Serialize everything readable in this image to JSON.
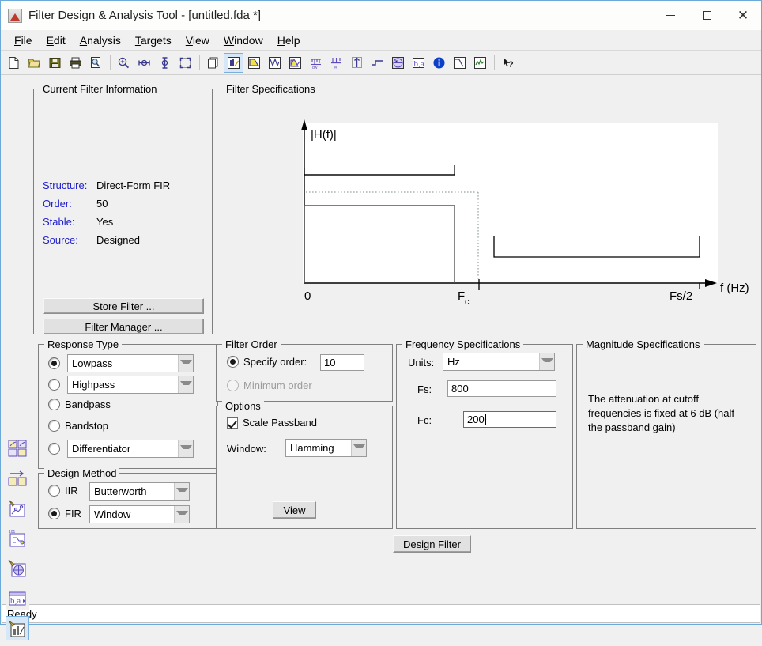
{
  "window": {
    "title": "Filter Design & Analysis Tool -  [untitled.fda *]",
    "app_icon": "matlab-fdatool-icon",
    "controls": {
      "minimize": "minimize-icon",
      "maximize": "maximize-icon",
      "close": "close-icon"
    }
  },
  "menubar": [
    {
      "label": "File",
      "mnemonic": "F"
    },
    {
      "label": "Edit",
      "mnemonic": "E"
    },
    {
      "label": "Analysis",
      "mnemonic": "A"
    },
    {
      "label": "Targets",
      "mnemonic": "T"
    },
    {
      "label": "View",
      "mnemonic": "V"
    },
    {
      "label": "Window",
      "mnemonic": "W"
    },
    {
      "label": "Help",
      "mnemonic": "H"
    }
  ],
  "toolbar": [
    {
      "name": "new-filter-icon",
      "tip": "New"
    },
    {
      "name": "open-icon",
      "tip": "Open"
    },
    {
      "name": "save-icon",
      "tip": "Save"
    },
    {
      "name": "print-icon",
      "tip": "Print"
    },
    {
      "name": "print-preview-icon",
      "tip": "Print Preview"
    },
    {
      "name": "zoom-in-icon",
      "tip": "Zoom In"
    },
    {
      "name": "zoom-x-icon",
      "tip": "Zoom X"
    },
    {
      "name": "zoom-y-icon",
      "tip": "Zoom Y"
    },
    {
      "name": "full-view-icon",
      "tip": "Full View"
    },
    {
      "name": "new-window-icon",
      "tip": "Print to Figure"
    },
    {
      "name": "filter-specifications-icon",
      "tip": "Filter Specifications",
      "active": true
    },
    {
      "name": "magnitude-response-icon",
      "tip": "Magnitude Response"
    },
    {
      "name": "phase-response-icon",
      "tip": "Phase Response"
    },
    {
      "name": "magnitude-and-phase-icon",
      "tip": "Magnitude and Phase Response"
    },
    {
      "name": "group-delay-icon",
      "tip": "Group Delay Response"
    },
    {
      "name": "phase-delay-icon",
      "tip": "Phase Delay"
    },
    {
      "name": "impulse-response-icon",
      "tip": "Impulse Response"
    },
    {
      "name": "step-response-icon",
      "tip": "Step Response"
    },
    {
      "name": "pole-zero-plot-icon",
      "tip": "Pole/Zero Plot"
    },
    {
      "name": "filter-coefficients-icon",
      "tip": "Filter Coefficients"
    },
    {
      "name": "filter-information-icon",
      "tip": "Filter Information"
    },
    {
      "name": "magnitude-specifications-icon",
      "tip": "Magnitude Specifications"
    },
    {
      "name": "round-off-noise-icon",
      "tip": "Round-off Noise Power Spectrum"
    },
    {
      "name": "help-pointer-icon",
      "tip": "Context Help"
    }
  ],
  "side_toolbar": [
    {
      "name": "design-filter-sidebar-icon",
      "tip": "Design Filter"
    },
    {
      "name": "import-filter-icon",
      "tip": "Import Filter"
    },
    {
      "name": "pole-zero-editor-icon",
      "tip": "Pole/Zero Editor"
    },
    {
      "name": "set-quantization-parameters-icon",
      "tip": "Set Quantization Parameters"
    },
    {
      "name": "transform-filter-icon",
      "tip": "Transform Filter"
    },
    {
      "name": "realize-model-icon",
      "tip": "Realize Model"
    },
    {
      "name": "design-multirate-filter-icon",
      "tip": "Design Multirate Filter",
      "active": true
    }
  ],
  "current_filter_information": {
    "legend": "Current Filter Information",
    "rows": [
      {
        "label": "Structure:",
        "value": "Direct-Form FIR"
      },
      {
        "label": "Order:",
        "value": "50"
      },
      {
        "label": "Stable:",
        "value": "Yes"
      },
      {
        "label": "Source:",
        "value": "Designed"
      }
    ],
    "store_filter_label": "Store Filter ...",
    "filter_manager_label": "Filter Manager ..."
  },
  "filter_specifications": {
    "legend": "Filter Specifications",
    "chart_data": {
      "type": "area",
      "title": "",
      "ylabel": "|H(f)|",
      "xlabel": "f (Hz)",
      "x_ticks": [
        "0",
        "Fc",
        "Fs/2"
      ],
      "grid": false,
      "legend_position": "none",
      "annotations": [
        {
          "text": "|H(f)|",
          "role": "y-axis-label"
        },
        {
          "text": "0",
          "role": "x-tick-origin"
        },
        {
          "text": "Fc",
          "role": "x-tick-cutoff"
        },
        {
          "text": "Fs/2",
          "role": "x-tick-nyquist"
        },
        {
          "text": "f (Hz)",
          "role": "x-axis-label"
        }
      ],
      "regions": [
        {
          "name": "passband-upper-bracket",
          "x_start": 0,
          "x_end": "Fc",
          "level": 0.72
        },
        {
          "name": "passband-ripple-dotted",
          "x_start": 0,
          "x_end": "Fc",
          "level": 0.6
        },
        {
          "name": "passband-lower-bracket",
          "x_start": 0,
          "x_end": "Fc",
          "level": 0.52
        },
        {
          "name": "stopband-bracket",
          "x_start": 0.56,
          "x_end": "Fs/2",
          "level": 0.11
        }
      ]
    }
  },
  "response_type": {
    "legend": "Response Type",
    "options": [
      {
        "label": "Lowpass",
        "type": "combo",
        "selected": true
      },
      {
        "label": "Highpass",
        "type": "combo",
        "selected": false
      },
      {
        "label": "Bandpass",
        "type": "radio",
        "selected": false
      },
      {
        "label": "Bandstop",
        "type": "radio",
        "selected": false
      },
      {
        "label": "Differentiator",
        "type": "combo",
        "selected": false
      }
    ]
  },
  "design_method": {
    "legend": "Design Method",
    "iir": {
      "label": "IIR",
      "selected": false,
      "value": "Butterworth"
    },
    "fir": {
      "label": "FIR",
      "selected": true,
      "value": "Window"
    }
  },
  "filter_order": {
    "legend": "Filter Order",
    "specify_order": {
      "label": "Specify order:",
      "selected": true,
      "value": "10"
    },
    "minimum_order": {
      "label": "Minimum order",
      "selected": false,
      "disabled": true
    }
  },
  "options": {
    "legend": "Options",
    "scale_passband": {
      "label": "Scale Passband",
      "checked": true
    },
    "window": {
      "label": "Window:",
      "value": "Hamming"
    },
    "view_button": "View"
  },
  "frequency_specifications": {
    "legend": "Frequency Specifications",
    "units": {
      "label": "Units:",
      "value": "Hz"
    },
    "fs": {
      "label": "Fs:",
      "value": "800"
    },
    "fc": {
      "label": "Fc:",
      "value": "200",
      "focused": true
    }
  },
  "magnitude_specifications": {
    "legend": "Magnitude Specifications",
    "text": "The attenuation at cutoff frequencies is fixed at 6 dB (half the passband gain)"
  },
  "design_filter_button": "Design Filter",
  "statusbar": {
    "text": "Ready"
  },
  "colors": {
    "window_border": "#6aa9d8",
    "panel_bg": "#f0f0f0",
    "group_border": "#7f7f7f",
    "label_blue": "#2020cc",
    "active_tool": "#d6e8f8",
    "plot_bg": "#ffffff",
    "icon_purple": "#5b4bbd",
    "icon_yellow": "#f4e04a"
  }
}
